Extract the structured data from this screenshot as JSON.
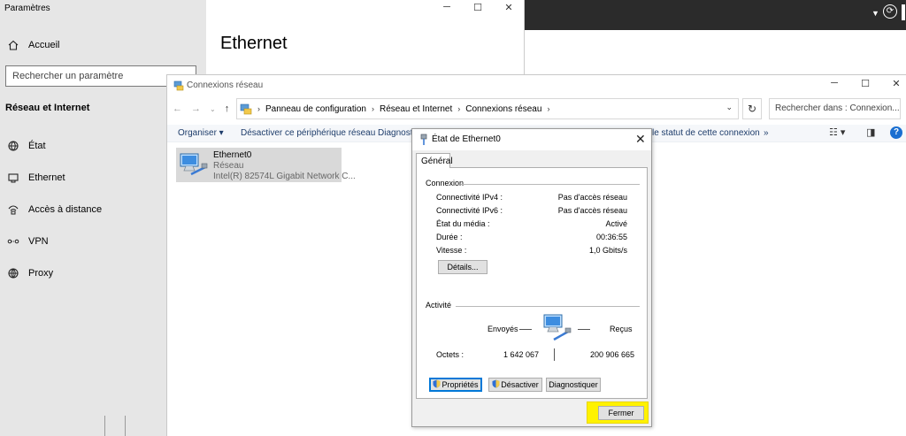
{
  "settings": {
    "window_title": "Paramètres",
    "home_label": "Accueil",
    "search_placeholder": "Rechercher un paramètre",
    "section_label": "Réseau et Internet",
    "nav_items": [
      {
        "label": "État",
        "icon": "globe-status-icon"
      },
      {
        "label": "Ethernet",
        "icon": "ethernet-icon"
      },
      {
        "label": "Accès à distance",
        "icon": "dialup-icon"
      },
      {
        "label": "VPN",
        "icon": "vpn-icon"
      },
      {
        "label": "Proxy",
        "icon": "globe-icon"
      }
    ],
    "page_title": "Ethernet"
  },
  "netconn": {
    "window_title": "Connexions réseau",
    "breadcrumb": [
      "Panneau de configuration",
      "Réseau et Internet",
      "Connexions réseau"
    ],
    "search_placeholder": "Rechercher dans : Connexion...",
    "toolbar": {
      "organize": "Organiser",
      "disable": "Désactiver ce périphérique réseau",
      "diagnose": "Diagnosti",
      "status": "le statut de cette connexion",
      "more": "»"
    },
    "item": {
      "name": "Ethernet0",
      "network": "Réseau",
      "adapter": "Intel(R) 82574L Gigabit Network C..."
    }
  },
  "dialog": {
    "title": "État de Ethernet0",
    "tab": "Général",
    "connection_group": "Connexion",
    "rows": [
      {
        "label": "Connectivité IPv4 :",
        "value": "Pas d'accès réseau"
      },
      {
        "label": "Connectivité IPv6 :",
        "value": "Pas d'accès réseau"
      },
      {
        "label": "État du média :",
        "value": "Activé"
      },
      {
        "label": "Durée :",
        "value": "00:36:55"
      },
      {
        "label": "Vitesse :",
        "value": "1,0 Gbits/s"
      }
    ],
    "details_button": "Détails...",
    "activity_group": "Activité",
    "sent_label": "Envoyés",
    "received_label": "Reçus",
    "bytes_label": "Octets :",
    "bytes_sent": "1 642 067",
    "bytes_received": "200 906 665",
    "properties_button": "Propriétés",
    "disable_button": "Désactiver",
    "diagnose_button": "Diagnostiquer",
    "close_button": "Fermer"
  },
  "colors": {
    "highlight": "#fff200",
    "accent": "#0078d7",
    "link_text": "#1e3d6b"
  }
}
